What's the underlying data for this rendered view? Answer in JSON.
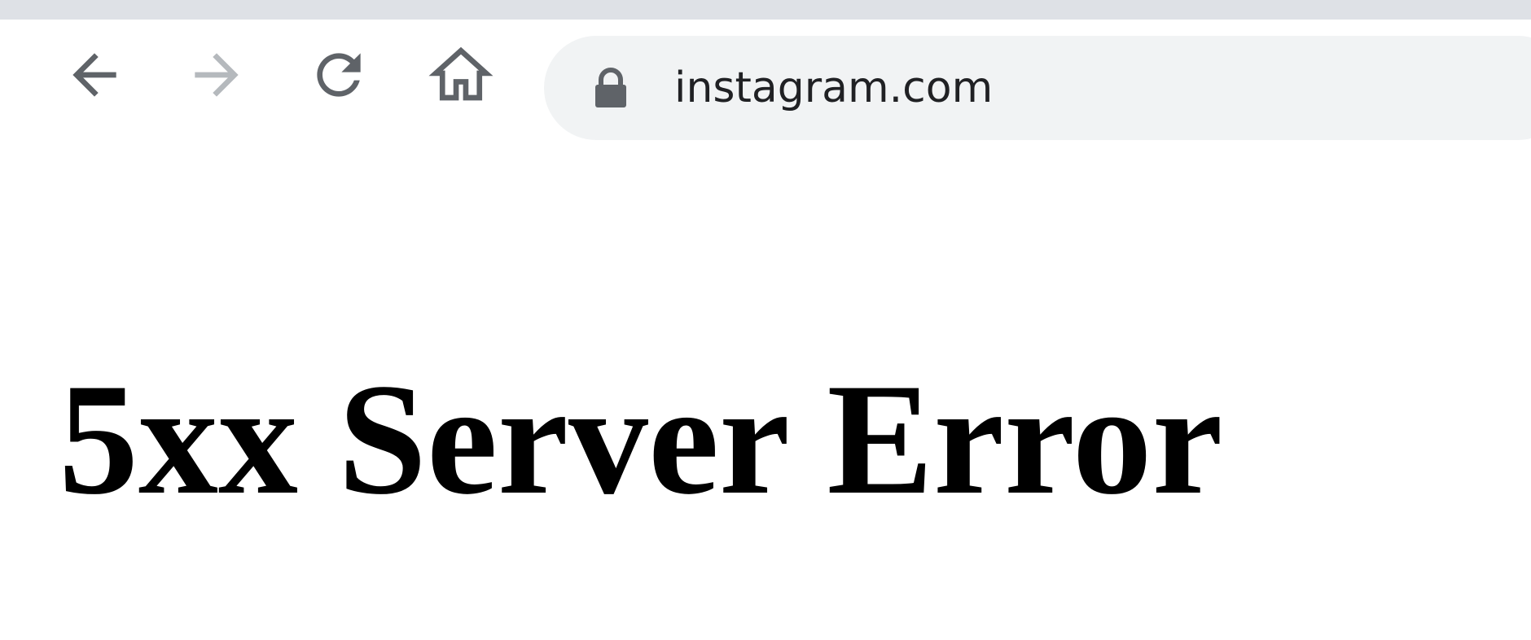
{
  "browser": {
    "toolbar": {
      "back": {
        "icon": "arrow-left-icon"
      },
      "forward": {
        "icon": "arrow-right-icon",
        "disabled": true
      },
      "reload": {
        "icon": "reload-icon"
      },
      "home": {
        "icon": "home-icon"
      }
    },
    "address_bar": {
      "security_icon": "lock-icon",
      "url": "instagram.com"
    }
  },
  "page": {
    "heading": "5xx Server Error"
  },
  "colors": {
    "tabstrip": "#dee1e6",
    "omnibox": "#f1f3f4",
    "icon_active": "#5f6368",
    "icon_disabled": "#b5b9bd",
    "text": "#202124",
    "heading": "#000000"
  }
}
